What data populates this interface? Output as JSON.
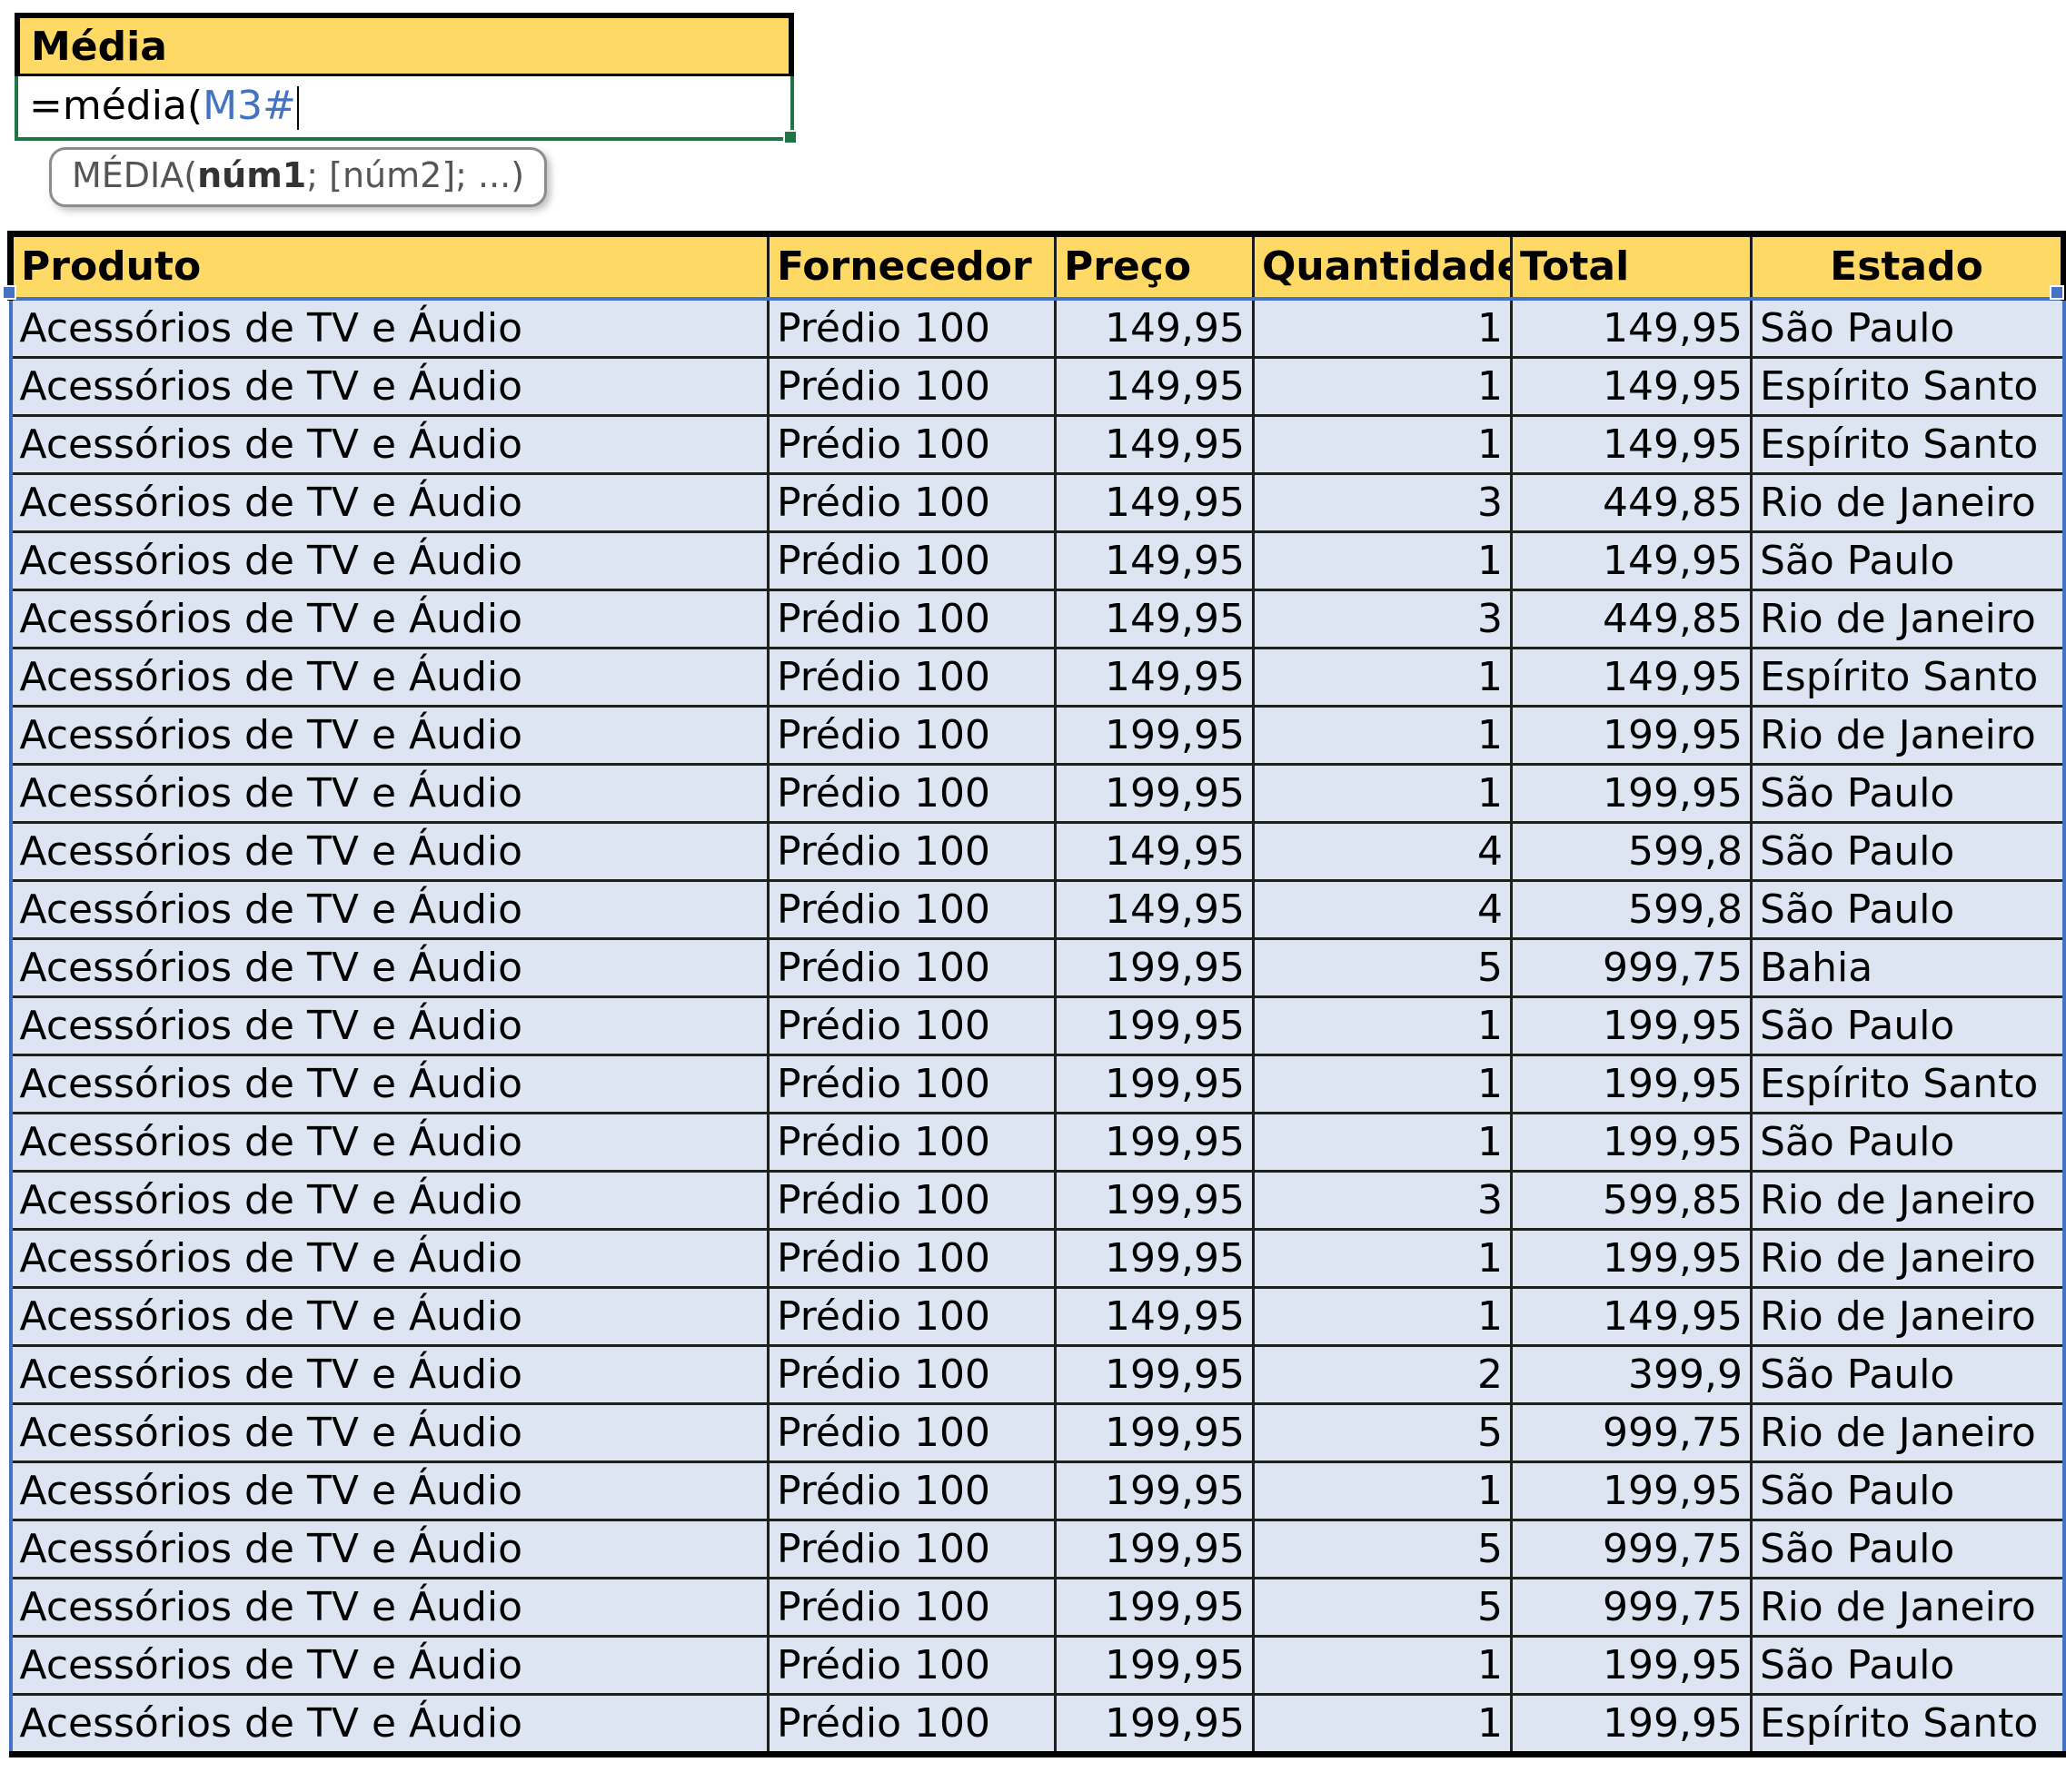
{
  "formula_box": {
    "header_label": "Média",
    "formula_prefix": "=média(",
    "formula_reference": "M3#",
    "tooltip_function": "MÉDIA(",
    "tooltip_arg1": "núm1",
    "tooltip_rest": "; [núm2]; ...)"
  },
  "table": {
    "columns": [
      "Produto",
      "Fornecedor",
      "Preço",
      "Quantidade",
      "Total",
      "Estado"
    ],
    "rows": [
      [
        "Acessórios de TV e Áudio",
        "Prédio 100",
        "149,95",
        "1",
        "149,95",
        "São Paulo"
      ],
      [
        "Acessórios de TV e Áudio",
        "Prédio 100",
        "149,95",
        "1",
        "149,95",
        "Espírito Santo"
      ],
      [
        "Acessórios de TV e Áudio",
        "Prédio 100",
        "149,95",
        "1",
        "149,95",
        "Espírito Santo"
      ],
      [
        "Acessórios de TV e Áudio",
        "Prédio 100",
        "149,95",
        "3",
        "449,85",
        "Rio de Janeiro"
      ],
      [
        "Acessórios de TV e Áudio",
        "Prédio 100",
        "149,95",
        "1",
        "149,95",
        "São Paulo"
      ],
      [
        "Acessórios de TV e Áudio",
        "Prédio 100",
        "149,95",
        "3",
        "449,85",
        "Rio de Janeiro"
      ],
      [
        "Acessórios de TV e Áudio",
        "Prédio 100",
        "149,95",
        "1",
        "149,95",
        "Espírito Santo"
      ],
      [
        "Acessórios de TV e Áudio",
        "Prédio 100",
        "199,95",
        "1",
        "199,95",
        "Rio de Janeiro"
      ],
      [
        "Acessórios de TV e Áudio",
        "Prédio 100",
        "199,95",
        "1",
        "199,95",
        "São Paulo"
      ],
      [
        "Acessórios de TV e Áudio",
        "Prédio 100",
        "149,95",
        "4",
        "599,8",
        "São Paulo"
      ],
      [
        "Acessórios de TV e Áudio",
        "Prédio 100",
        "149,95",
        "4",
        "599,8",
        "São Paulo"
      ],
      [
        "Acessórios de TV e Áudio",
        "Prédio 100",
        "199,95",
        "5",
        "999,75",
        "Bahia"
      ],
      [
        "Acessórios de TV e Áudio",
        "Prédio 100",
        "199,95",
        "1",
        "199,95",
        "São Paulo"
      ],
      [
        "Acessórios de TV e Áudio",
        "Prédio 100",
        "199,95",
        "1",
        "199,95",
        "Espírito Santo"
      ],
      [
        "Acessórios de TV e Áudio",
        "Prédio 100",
        "199,95",
        "1",
        "199,95",
        "São Paulo"
      ],
      [
        "Acessórios de TV e Áudio",
        "Prédio 100",
        "199,95",
        "3",
        "599,85",
        "Rio de Janeiro"
      ],
      [
        "Acessórios de TV e Áudio",
        "Prédio 100",
        "199,95",
        "1",
        "199,95",
        "Rio de Janeiro"
      ],
      [
        "Acessórios de TV e Áudio",
        "Prédio 100",
        "149,95",
        "1",
        "149,95",
        "Rio de Janeiro"
      ],
      [
        "Acessórios de TV e Áudio",
        "Prédio 100",
        "199,95",
        "2",
        "399,9",
        "São Paulo"
      ],
      [
        "Acessórios de TV e Áudio",
        "Prédio 100",
        "199,95",
        "5",
        "999,75",
        "Rio de Janeiro"
      ],
      [
        "Acessórios de TV e Áudio",
        "Prédio 100",
        "199,95",
        "1",
        "199,95",
        "São Paulo"
      ],
      [
        "Acessórios de TV e Áudio",
        "Prédio 100",
        "199,95",
        "5",
        "999,75",
        "São Paulo"
      ],
      [
        "Acessórios de TV e Áudio",
        "Prédio 100",
        "199,95",
        "5",
        "999,75",
        "Rio de Janeiro"
      ],
      [
        "Acessórios de TV e Áudio",
        "Prédio 100",
        "199,95",
        "1",
        "199,95",
        "São Paulo"
      ],
      [
        "Acessórios de TV e Áudio",
        "Prédio 100",
        "199,95",
        "1",
        "199,95",
        "Espírito Santo"
      ]
    ]
  },
  "colors": {
    "header_fill": "#ffd966",
    "row_fill": "#dde5f2",
    "reference_blue": "#4472c4",
    "active_cell_green": "#217346"
  }
}
